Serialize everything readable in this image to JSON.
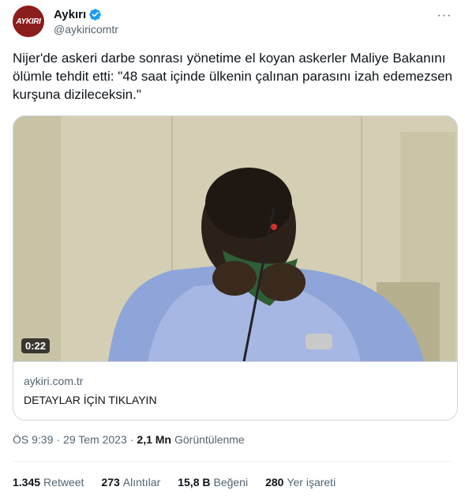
{
  "author": {
    "avatar_text": "AYKIRI",
    "display_name": "Aykırı",
    "handle": "@aykiricomtr",
    "verified": true,
    "verified_color": "#1d9bf0",
    "avatar_color": "#8b1d1d"
  },
  "more_icon": "more-horizontal-icon",
  "more_label": "···",
  "tweet": {
    "text": "Nijer'de askeri darbe sonrası yönetime el koyan askerler Maliye Bakanını ölümle tehdit etti: \"48 saat içinde ülkenin çalınan parasını izah edemezsen kurşuna dizileceksin.\""
  },
  "card": {
    "duration": "0:22",
    "domain": "aykiri.com.tr",
    "title": "DETAYLAR İÇİN TIKLAYIN"
  },
  "meta": {
    "time": "ÖS 9:39",
    "sep1": "·",
    "date": "29 Tem 2023",
    "sep2": "·",
    "views": "2,1 Mn",
    "views_label": "Görüntülenme"
  },
  "stats": {
    "retweets": "1.345",
    "retweets_label": "Retweet",
    "quotes": "273",
    "quotes_label": "Alıntılar",
    "likes": "15,8 B",
    "likes_label": "Beğeni",
    "bookmarks": "280",
    "bookmarks_label": "Yer işareti"
  }
}
